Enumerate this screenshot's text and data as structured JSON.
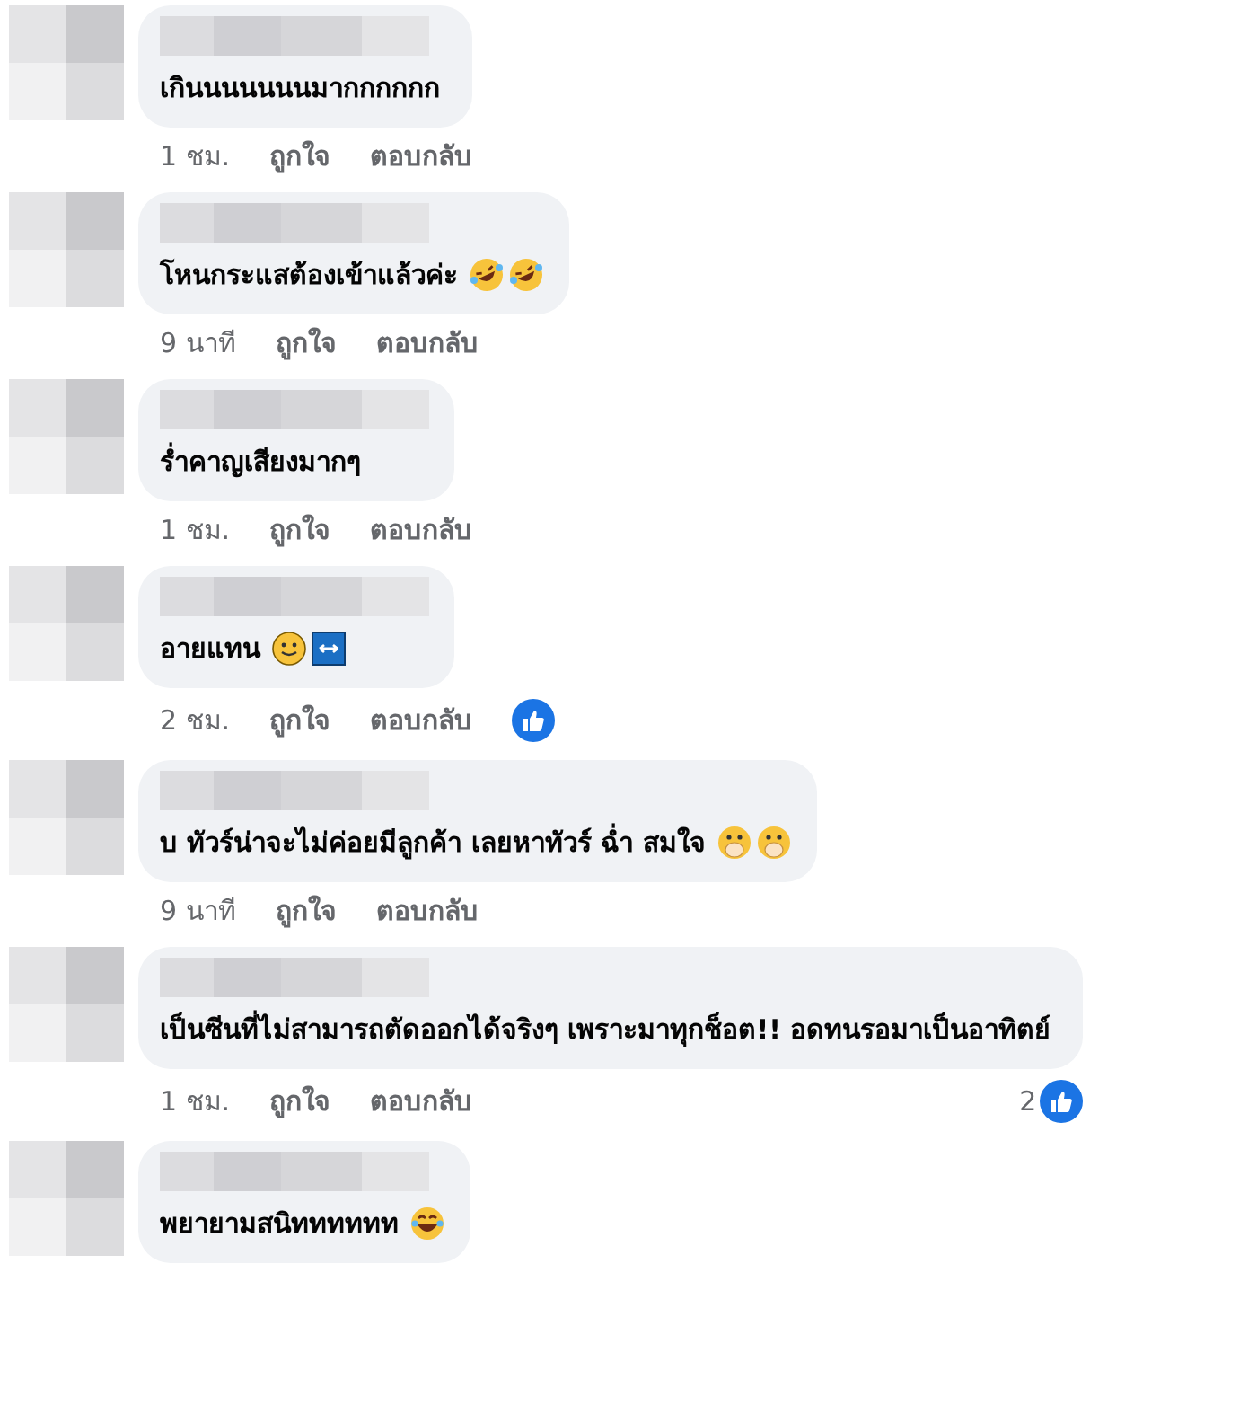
{
  "comments": [
    {
      "text": "เกินนนนนนนมากกกกกก",
      "time": "1 ชม.",
      "like": "ถูกใจ",
      "reply": "ตอบกลับ"
    },
    {
      "text": "โหนกระแสต้องเข้าแล้วค่ะ",
      "emojis": [
        {
          "kind": "rofl"
        },
        {
          "kind": "rofl"
        }
      ],
      "time": "9 นาที",
      "like": "ถูกใจ",
      "reply": "ตอบกลับ"
    },
    {
      "text": "ร่ำคาญเสียงมากๆ",
      "time": "1 ชม.",
      "like": "ถูกใจ",
      "reply": "ตอบกลับ"
    },
    {
      "text": "อายแทน",
      "emojis": [
        {
          "kind": "smile"
        },
        {
          "kind": "arrow"
        }
      ],
      "time": "2 ชม.",
      "like": "ถูกใจ",
      "reply": "ตอบกลับ",
      "reaction": {
        "kind": "like"
      }
    },
    {
      "text": "บ ทัวร์น่าจะไม่ค่อยมีลูกค้า เลยหาทัวร์ ฉ่ำ สมใจ",
      "emojis": [
        {
          "kind": "hand"
        },
        {
          "kind": "hand"
        }
      ],
      "time": "9 นาที",
      "like": "ถูกใจ",
      "reply": "ตอบกลับ"
    },
    {
      "text": "เป็นซีนที่ไม่สามารถตัดออกได้จริงๆ เพราะมาทุกช็อต!! อดทนรอมาเป็นอาทิตย์",
      "time": "1 ชม.",
      "like": "ถูกใจ",
      "reply": "ตอบกลับ",
      "reaction": {
        "kind": "like",
        "count": "2"
      }
    },
    {
      "text": "พยายามสนิทททททท",
      "emojis": [
        {
          "kind": "joy"
        }
      ]
    }
  ]
}
